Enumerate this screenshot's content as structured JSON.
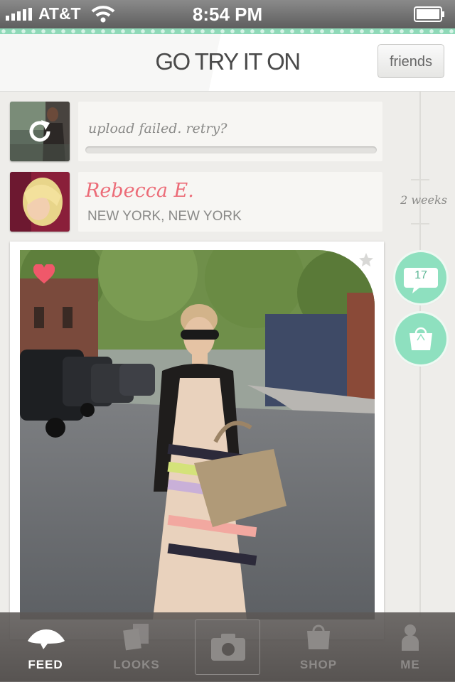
{
  "status_bar": {
    "carrier": "AT&T",
    "time": "8:54 PM"
  },
  "header": {
    "title": "GO TRY IT ON",
    "friends_label": "friends"
  },
  "upload": {
    "status_text": "upload failed.  retry?",
    "progress": 0
  },
  "post": {
    "user_name": "Rebecca E.",
    "user_location": "NEW YORK, NEW YORK",
    "time_ago": "2 weeks",
    "comment_count": "17",
    "liked": true,
    "starred": false
  },
  "tab_bar": {
    "tabs": [
      {
        "label": "FEED",
        "active": true
      },
      {
        "label": "LOOKS",
        "active": false
      },
      {
        "label": "",
        "active": false
      },
      {
        "label": "SHOP",
        "active": false
      },
      {
        "label": "ME",
        "active": false
      }
    ]
  },
  "colors": {
    "accent_mint": "#8ee0bf",
    "name_pink": "#ec6c78",
    "heart_red": "#f0586a"
  }
}
